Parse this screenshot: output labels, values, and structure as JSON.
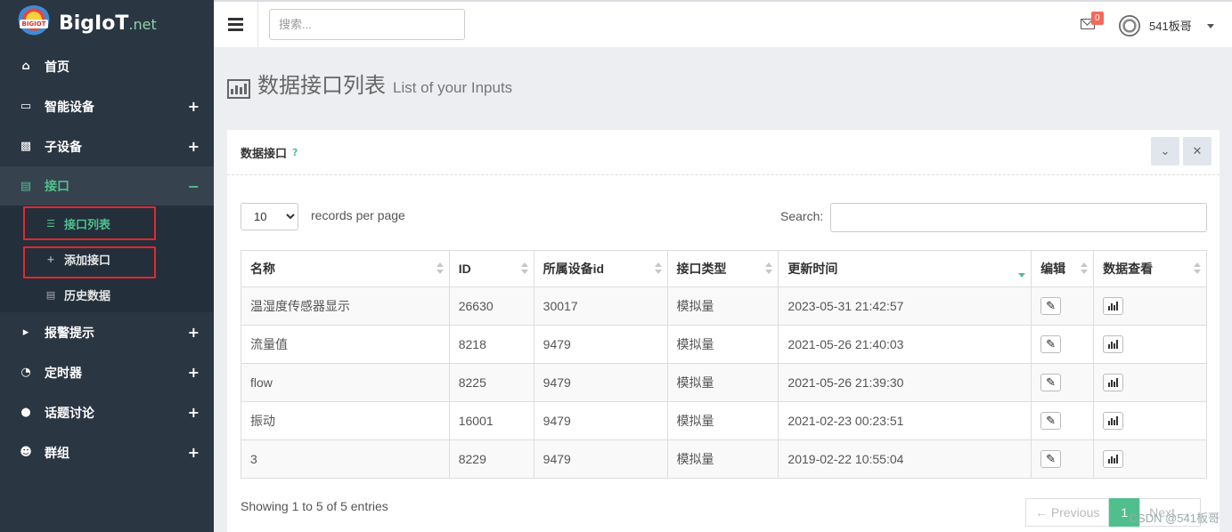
{
  "brand": {
    "logo_badge": "BIGIOT",
    "name": "BigIoT",
    "suffix": ".net"
  },
  "sidebar": {
    "items": [
      {
        "label": "首页",
        "icon": "home-icon",
        "toggle": ""
      },
      {
        "label": "智能设备",
        "icon": "laptop-icon",
        "toggle": "+"
      },
      {
        "label": "子设备",
        "icon": "sitemap-icon",
        "toggle": "+"
      },
      {
        "label": "接口",
        "icon": "bar-chart-icon",
        "toggle": "−"
      },
      {
        "label": "报警提示",
        "icon": "volume-icon",
        "toggle": "+"
      },
      {
        "label": "定时器",
        "icon": "clock-icon",
        "toggle": "+"
      },
      {
        "label": "话题讨论",
        "icon": "comments-icon",
        "toggle": "+"
      },
      {
        "label": "群组",
        "icon": "users-icon",
        "toggle": "+"
      }
    ],
    "subitems": [
      {
        "label": "接口列表",
        "icon": "list-icon"
      },
      {
        "label": "添加接口",
        "icon": "plus-icon"
      },
      {
        "label": "历史数据",
        "icon": "bar-chart-icon"
      }
    ]
  },
  "topbar": {
    "search_placeholder": "搜索...",
    "mail_count": "0",
    "user_name": "541板哥"
  },
  "page": {
    "title": "数据接口列表",
    "subtitle": "List of your Inputs"
  },
  "portlet": {
    "title": "数据接口",
    "help": "?"
  },
  "table_controls": {
    "page_size": "10",
    "page_size_label": "records per page",
    "search_label": "Search:"
  },
  "table": {
    "headers": [
      "名称",
      "ID",
      "所属设备id",
      "接口类型",
      "更新时间",
      "编辑",
      "数据查看"
    ],
    "rows": [
      [
        "温湿度传感器显示",
        "26630",
        "30017",
        "模拟量",
        "2023-05-31 21:42:57"
      ],
      [
        "流量值",
        "8218",
        "9479",
        "模拟量",
        "2021-05-26 21:40:03"
      ],
      [
        "flow",
        "8225",
        "9479",
        "模拟量",
        "2021-05-26 21:39:30"
      ],
      [
        "振动",
        "16001",
        "9479",
        "模拟量",
        "2021-02-23 00:23:51"
      ],
      [
        "3",
        "8229",
        "9479",
        "模拟量",
        "2019-02-22 10:55:04"
      ]
    ]
  },
  "footer": {
    "info": "Showing 1 to 5 of 5 entries",
    "prev": "← Previous",
    "page": "1",
    "next": "Next →"
  },
  "watermark": "CSDN @541板哥",
  "colors": {
    "sidebar": "#2b3643",
    "accent": "#4fc08d",
    "highlight_box": "#e6262b"
  }
}
